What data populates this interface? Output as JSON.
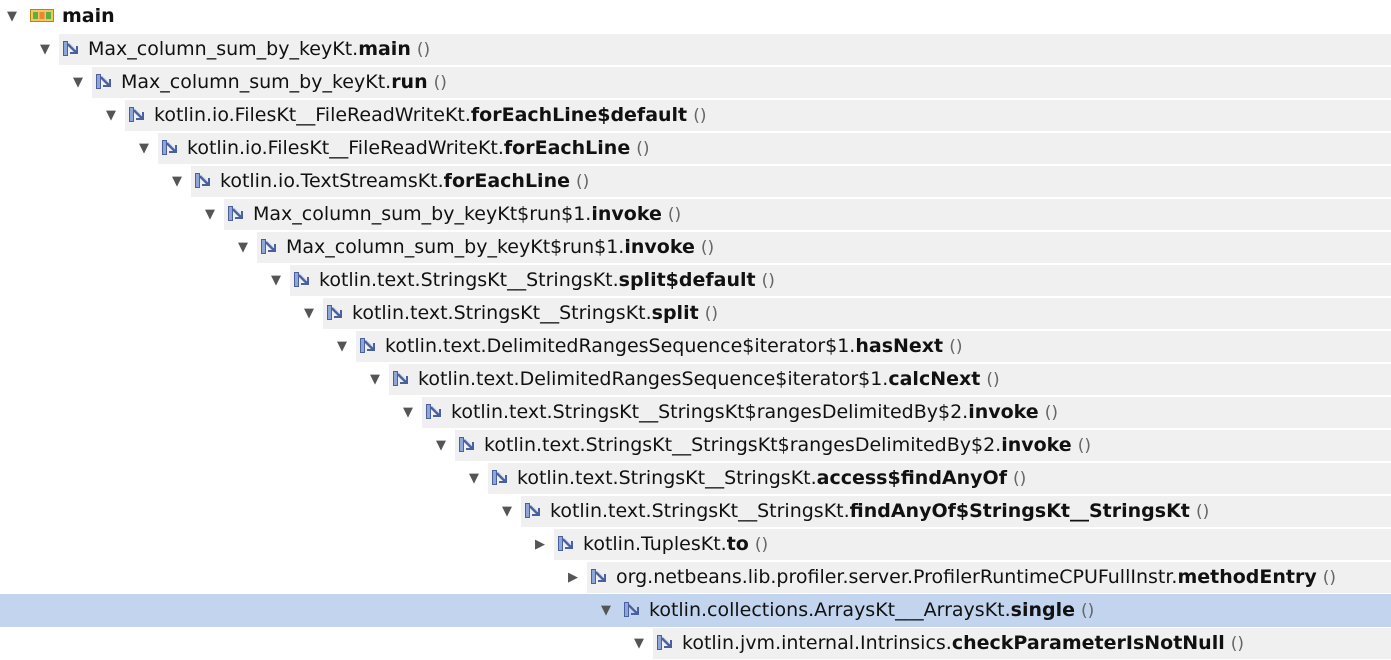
{
  "root": {
    "label": "main",
    "toggle": "▼"
  },
  "rows": [
    {
      "cls": "Max_column_sum_by_keyKt.",
      "method": "main",
      "args": "()",
      "toggle": "▼"
    },
    {
      "cls": "Max_column_sum_by_keyKt.",
      "method": "run",
      "args": "()",
      "toggle": "▼"
    },
    {
      "cls": "kotlin.io.FilesKt__FileReadWriteKt.",
      "method": "forEachLine$default",
      "args": "()",
      "toggle": "▼"
    },
    {
      "cls": "kotlin.io.FilesKt__FileReadWriteKt.",
      "method": "forEachLine",
      "args": "()",
      "toggle": "▼"
    },
    {
      "cls": "kotlin.io.TextStreamsKt.",
      "method": "forEachLine",
      "args": "()",
      "toggle": "▼"
    },
    {
      "cls": "Max_column_sum_by_keyKt$run$1.",
      "method": "invoke",
      "args": "()",
      "toggle": "▼"
    },
    {
      "cls": "Max_column_sum_by_keyKt$run$1.",
      "method": "invoke",
      "args": "()",
      "toggle": "▼"
    },
    {
      "cls": "kotlin.text.StringsKt__StringsKt.",
      "method": "split$default",
      "args": "()",
      "toggle": "▼"
    },
    {
      "cls": "kotlin.text.StringsKt__StringsKt.",
      "method": "split",
      "args": "()",
      "toggle": "▼"
    },
    {
      "cls": "kotlin.text.DelimitedRangesSequence$iterator$1.",
      "method": "hasNext",
      "args": "()",
      "toggle": "▼"
    },
    {
      "cls": "kotlin.text.DelimitedRangesSequence$iterator$1.",
      "method": "calcNext",
      "args": "()",
      "toggle": "▼"
    },
    {
      "cls": "kotlin.text.StringsKt__StringsKt$rangesDelimitedBy$2.",
      "method": "invoke",
      "args": "()",
      "toggle": "▼"
    },
    {
      "cls": "kotlin.text.StringsKt__StringsKt$rangesDelimitedBy$2.",
      "method": "invoke",
      "args": "()",
      "toggle": "▼"
    },
    {
      "cls": "kotlin.text.StringsKt__StringsKt.",
      "method": "access$findAnyOf",
      "args": "()",
      "toggle": "▼"
    },
    {
      "cls": "kotlin.text.StringsKt__StringsKt.",
      "method": "findAnyOf$StringsKt__StringsKt",
      "args": "()",
      "toggle": "▼"
    },
    {
      "cls": "kotlin.TuplesKt.",
      "method": "to",
      "args": "()",
      "toggle": "▶"
    },
    {
      "cls": "org.netbeans.lib.profiler.server.ProfilerRuntimeCPUFullInstr.",
      "method": "methodEntry",
      "args": "()",
      "toggle": "▶"
    },
    {
      "cls": "kotlin.collections.ArraysKt___ArraysKt.",
      "method": "single",
      "args": "()",
      "toggle": "▼"
    },
    {
      "cls": "kotlin.jvm.internal.Intrinsics.",
      "method": "checkParameterIsNotNull",
      "args": "()",
      "toggle": "▼"
    }
  ],
  "selected_index": 17,
  "colors": {
    "selection": "#c3d5ee",
    "band": "#f0f0f0",
    "method_icon_blue": "#4a5f9e",
    "thread_icon_orange": "#f5a623",
    "thread_icon_green": "#5fae3e"
  },
  "icons": {
    "root": "thread-icon",
    "node": "method-call-icon"
  }
}
